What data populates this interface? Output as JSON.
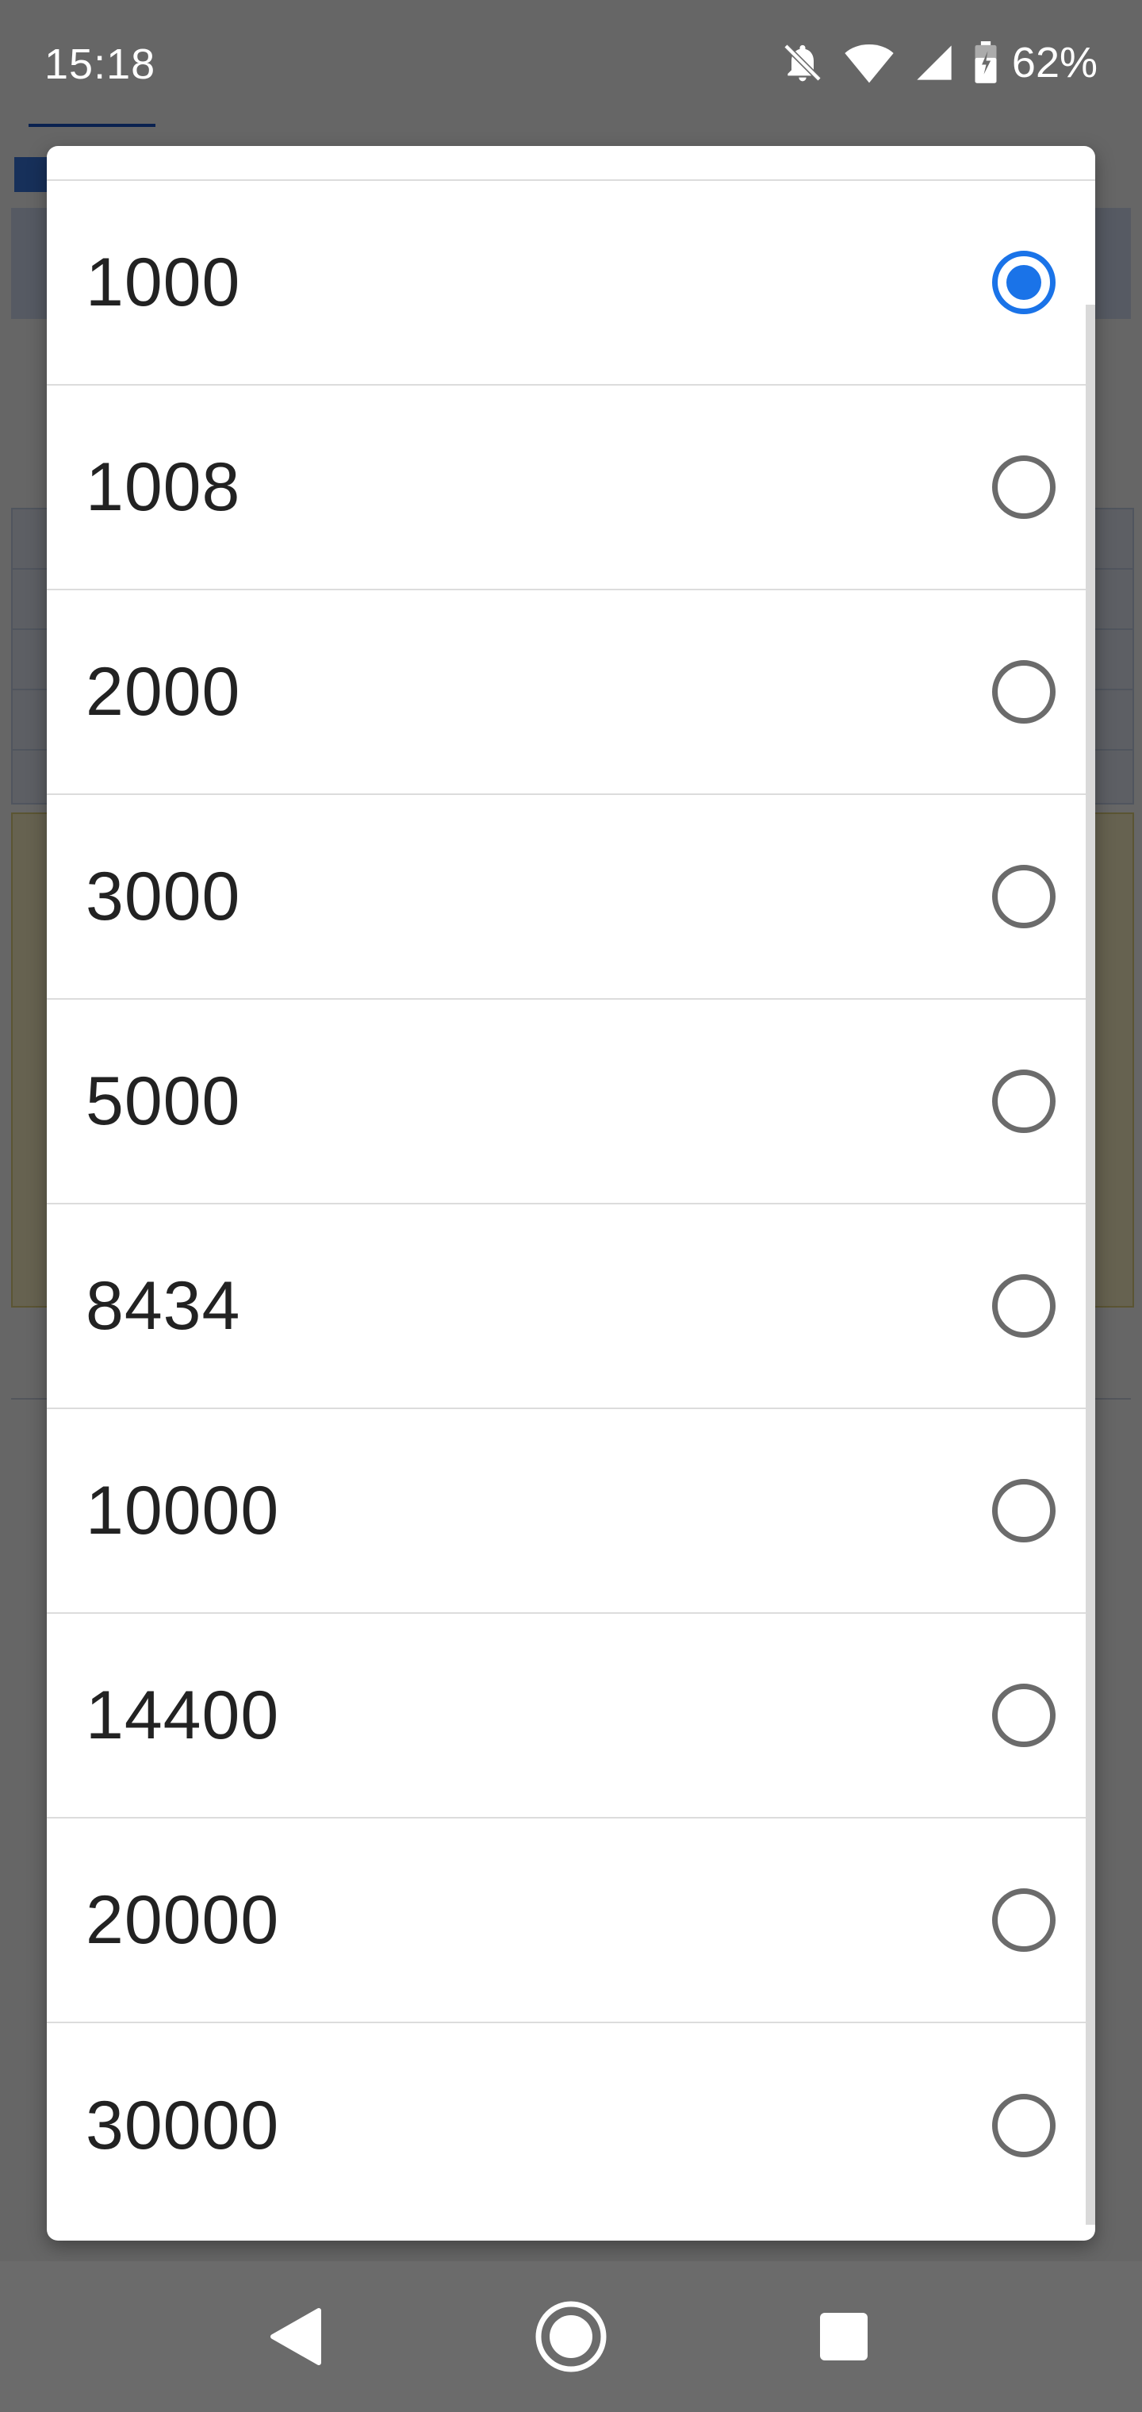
{
  "status_bar": {
    "time": "15:18",
    "battery_percent": "62%",
    "icons": [
      "notifications-off-icon",
      "wifi-icon",
      "signal-icon",
      "battery-icon"
    ]
  },
  "dialog": {
    "options": [
      {
        "label": "1000",
        "selected": true
      },
      {
        "label": "1008",
        "selected": false
      },
      {
        "label": "2000",
        "selected": false
      },
      {
        "label": "3000",
        "selected": false
      },
      {
        "label": "5000",
        "selected": false
      },
      {
        "label": "8434",
        "selected": false
      },
      {
        "label": "10000",
        "selected": false
      },
      {
        "label": "14400",
        "selected": false
      },
      {
        "label": "20000",
        "selected": false
      },
      {
        "label": "30000",
        "selected": false
      }
    ]
  },
  "nav_bar": {
    "icons": [
      "back-icon",
      "home-icon",
      "recents-icon"
    ]
  },
  "colors": {
    "accent": "#1a73e8",
    "scrim": "#6b6b6b",
    "text": "#222222"
  }
}
